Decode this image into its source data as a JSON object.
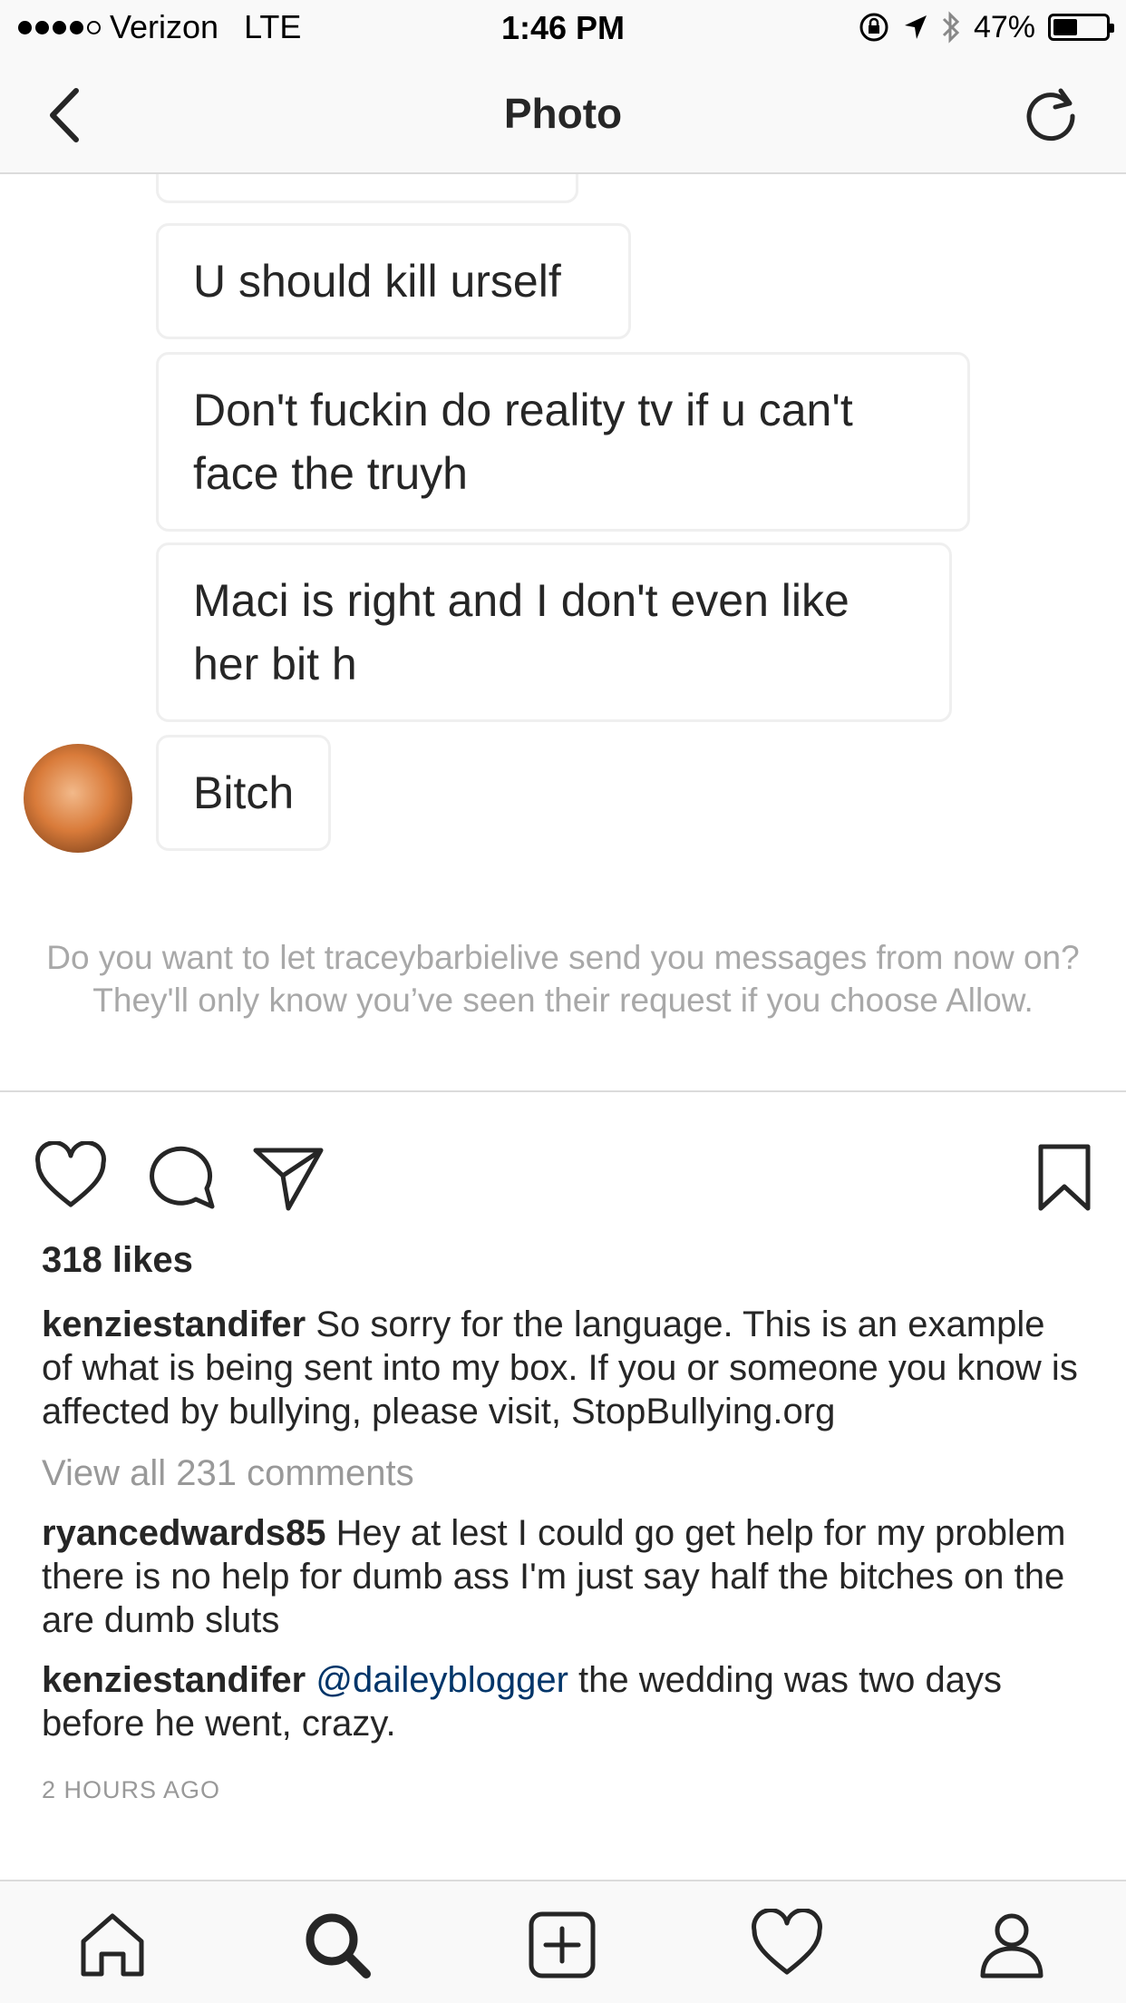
{
  "status_bar": {
    "carrier": "Verizon",
    "network": "LTE",
    "time": "1:46 PM",
    "battery_percent": "47%",
    "battery_level": 0.47
  },
  "nav": {
    "title": "Photo",
    "back_icon": "chevron-left-icon",
    "refresh_icon": "refresh-icon"
  },
  "messages": [
    {
      "text": "U should kill urself"
    },
    {
      "text": "Don't fuckin do reality tv if u can't face the truyh"
    },
    {
      "text": "Maci is right and I don't even like her bit h"
    },
    {
      "text": "Bitch"
    }
  ],
  "request_prompt": "Do you want to let traceybarbielive send you messages from now on? They'll only know you’ve seen their request if you choose Allow.",
  "post": {
    "likes": "318 likes",
    "caption": {
      "user": "kenziestandifer",
      "text": "So sorry for the language. This is an example of what is being sent into my box. If you or someone you know is affected by bullying, please visit, StopBullying.org"
    },
    "view_all_comments": "View all 231 comments",
    "comments": [
      {
        "user": "ryancedwards85",
        "text": "Hey at lest I could go get help for my problem there is no help for dumb ass I'm just say half the bitches on the are dumb sluts"
      },
      {
        "user": "kenziestandifer",
        "mention": "@daileyblogger",
        "text": "the wedding was two days before he went, crazy."
      }
    ],
    "timestamp": "2 HOURS AGO"
  },
  "colors": {
    "text": "#262626",
    "muted": "#999999",
    "mention": "#003569",
    "bar_bg": "#f9f9f9",
    "divider": "#dbdbdb"
  }
}
